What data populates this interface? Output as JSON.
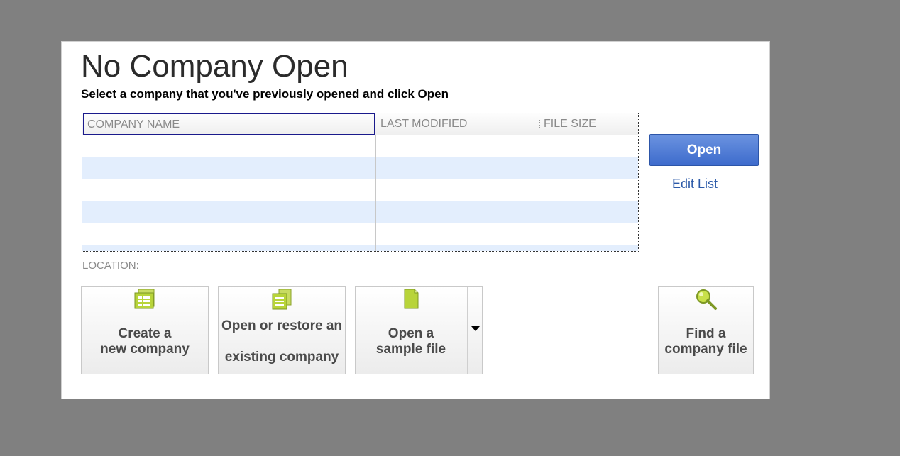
{
  "dialog": {
    "title": "No Company Open",
    "subtitle": "Select a company that you've previously opened and click Open"
  },
  "table": {
    "columns": [
      "COMPANY NAME",
      "LAST MODIFIED",
      "FILE SIZE"
    ],
    "rows": []
  },
  "location_label": "LOCATION:",
  "actions": {
    "open_label": "Open",
    "edit_list_label": "Edit List"
  },
  "tiles": [
    {
      "icon": "create-company-icon",
      "line1": "Create a",
      "line2": "new company"
    },
    {
      "icon": "open-restore-icon",
      "line1": "Open or restore an",
      "line2": "existing company"
    },
    {
      "icon": "sample-file-icon",
      "line1": "Open a",
      "line2": "sample file"
    },
    {
      "icon": "magnifier-icon",
      "line1": "Find a",
      "line2": "company file"
    }
  ],
  "colors": {
    "accent": "#3d6bcc",
    "row_alt": "#e3eefd",
    "icon_green": "#b8d43a",
    "background": "#808080"
  }
}
